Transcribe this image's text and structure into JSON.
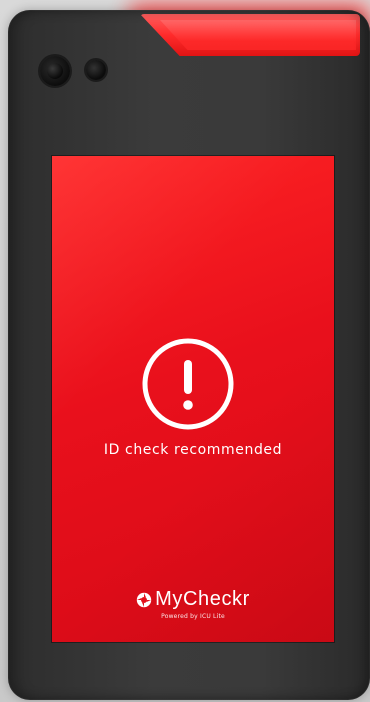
{
  "screen": {
    "status_text": "ID check recommended",
    "status_icon": "alert-circle-icon",
    "background_color": "#e3101b"
  },
  "brand": {
    "name": "MyCheckr",
    "subtitle": "Powered by ICU Lite"
  },
  "device": {
    "led_color": "#ff2b2b"
  }
}
